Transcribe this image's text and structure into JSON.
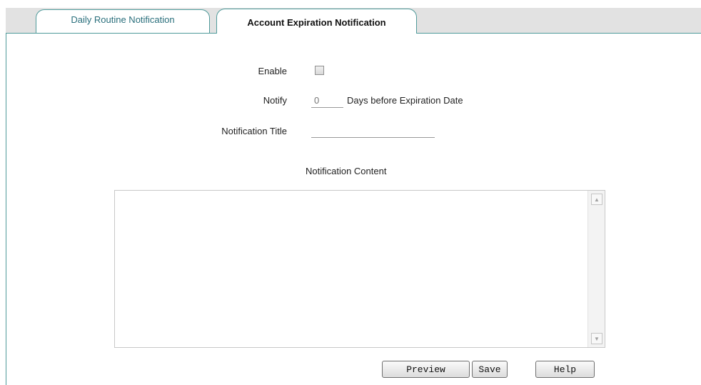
{
  "tabs": {
    "daily": "Daily Routine Notification",
    "account": "Account Expiration Notification"
  },
  "form": {
    "enable_label": "Enable",
    "enable_checked": false,
    "notify_label": "Notify",
    "notify_placeholder": "0",
    "notify_suffix": "Days before Expiration Date",
    "title_label": "Notification Title",
    "title_value": "",
    "content_label": "Notification Content",
    "content_value": ""
  },
  "buttons": {
    "preview": "Preview",
    "save": "Save",
    "help": "Help"
  },
  "icons": {
    "scroll_up": "scroll-up-arrow-icon",
    "scroll_down": "scroll-down-arrow-icon"
  },
  "colors": {
    "tab_border": "#4f9a9a",
    "tab_text": "#2a6f7c",
    "tabbar_bg": "#e2e2e2"
  }
}
